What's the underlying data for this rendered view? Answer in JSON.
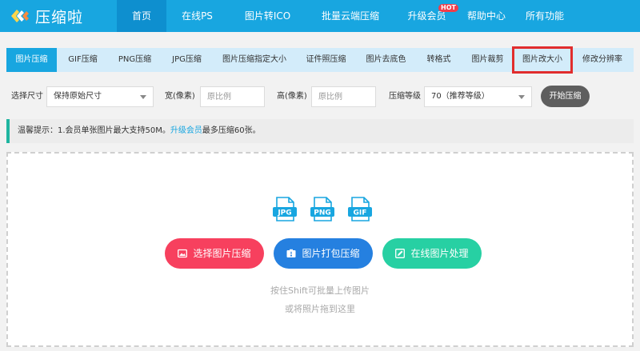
{
  "header": {
    "logo_text": "压缩啦",
    "nav": [
      {
        "label": "首页",
        "active": true
      },
      {
        "label": "在线PS"
      },
      {
        "label": "图片转ICO"
      },
      {
        "label": "批量云端压缩"
      },
      {
        "label": "升级会员",
        "badge": "HOT"
      },
      {
        "label": "帮助中心"
      },
      {
        "label": "所有功能"
      }
    ]
  },
  "tabs": [
    {
      "label": "图片压缩",
      "active": true
    },
    {
      "label": "GIF压缩"
    },
    {
      "label": "PNG压缩"
    },
    {
      "label": "JPG压缩"
    },
    {
      "label": "图片压缩指定大小"
    },
    {
      "label": "证件照压缩"
    },
    {
      "label": "图片去底色"
    },
    {
      "label": "转格式"
    },
    {
      "label": "图片裁剪"
    },
    {
      "label": "图片改大小",
      "highlighted": true
    },
    {
      "label": "修改分辨率"
    }
  ],
  "options": {
    "size_label": "选择尺寸",
    "size_value": "保持原始尺寸",
    "width_label": "宽(像素)",
    "width_placeholder": "原比例",
    "height_label": "高(像素)",
    "height_placeholder": "原比例",
    "level_label": "压缩等级",
    "level_value": "70（推荐等级）",
    "start_label": "开始压缩"
  },
  "notice": {
    "prefix": "温馨提示：1.会员单张图片最大支持50M。",
    "link": "升级会员",
    "suffix": "最多压缩60张。"
  },
  "upload": {
    "formats": [
      "JPG",
      "PNG",
      "GIF"
    ],
    "buttons": {
      "select": "选择图片压缩",
      "zip": "图片打包压缩",
      "online": "在线图片处理"
    },
    "hint1": "按住Shift可批量上传图片",
    "hint2": "或将照片拖到这里"
  },
  "colors": {
    "brand": "#18a6e0",
    "red": "#f7405e",
    "blue": "#2580e0",
    "green": "#27d0a3",
    "highlight": "#e12d2d"
  }
}
